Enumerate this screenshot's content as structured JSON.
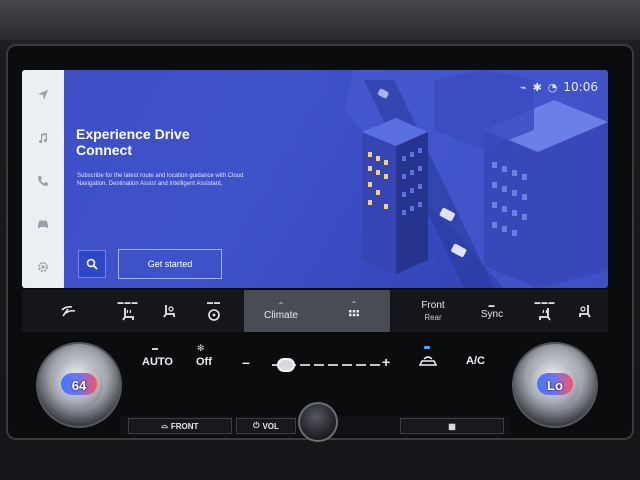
{
  "screen": {
    "status": {
      "clock": "10:06"
    },
    "nav_items": [
      {
        "icon": "navigation-arrow-icon"
      },
      {
        "icon": "music-note-icon"
      },
      {
        "icon": "phone-icon"
      },
      {
        "icon": "car-icon"
      },
      {
        "icon": "gear-icon"
      }
    ],
    "promo": {
      "title_line1": "Experience Drive",
      "title_line2": "Connect",
      "description": "Subscribe for the latest route and location guidance with Cloud Navigation, Destination Assist and Intelligent Assistant.",
      "button_label": "Get started"
    }
  },
  "climate_bar": {
    "climate_label": "Climate",
    "front_label": "Front",
    "rear_label": "Rear",
    "sync_label": "Sync"
  },
  "controls": {
    "left_temp": "64",
    "right_temp": "Lo",
    "auto_label": "AUTO",
    "off_label": "Off",
    "minus_label": "–",
    "plus_label": "+",
    "ac_label": "A/C",
    "fan_level_fraction": 0.05
  },
  "bottom_strip": {
    "front_label": "FRONT",
    "vol_label": "VOL"
  },
  "colors": {
    "screen_blue": "#3d4fc6",
    "cold": "#3f73ff",
    "hot": "#ff4d5a"
  }
}
